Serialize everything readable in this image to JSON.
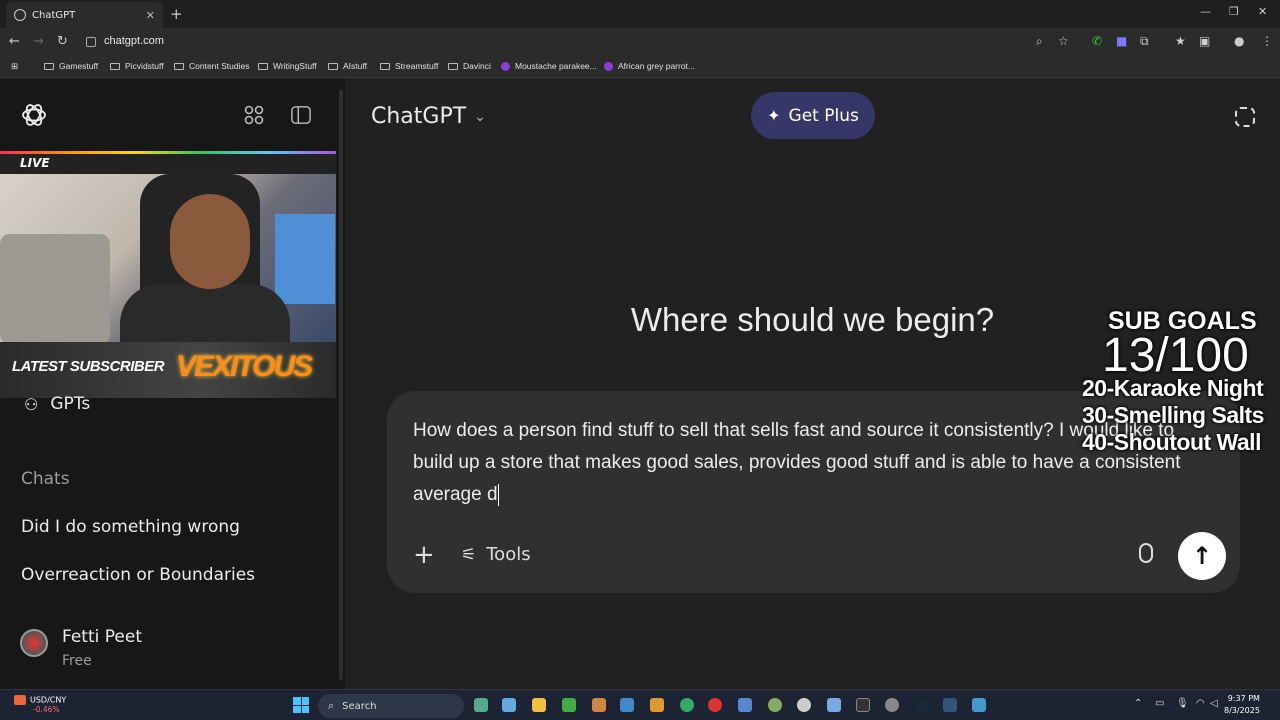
{
  "browser": {
    "tab_title": "ChatGPT",
    "tab_close": "✕",
    "new_tab": "+",
    "url": "chatgpt.com",
    "bookmarks": [
      {
        "label": "Gamestuff",
        "type": "folder"
      },
      {
        "label": "Picvidstuff",
        "type": "folder"
      },
      {
        "label": "Content Studies",
        "type": "folder"
      },
      {
        "label": "WritingStuff",
        "type": "folder"
      },
      {
        "label": "AIstuff",
        "type": "folder"
      },
      {
        "label": "Streamstuff",
        "type": "folder"
      },
      {
        "label": "Davinci",
        "type": "folder"
      },
      {
        "label": "Moustache parakee...",
        "type": "site"
      },
      {
        "label": "African grey parrot...",
        "type": "site"
      }
    ]
  },
  "sidebar": {
    "live_label": "LIVE",
    "latest_subscriber_label": "LATEST SUBSCRIBER",
    "latest_subscriber_name": "VEXITOUS",
    "gpts_label": "GPTs",
    "chats_heading": "Chats",
    "chats": [
      "Did I do something wrong",
      "Overreaction or Boundaries"
    ],
    "user": {
      "name": "Fetti Peet",
      "plan": "Free"
    }
  },
  "main": {
    "model_name": "ChatGPT",
    "get_plus_label": "Get Plus",
    "headline": "Where should we begin?",
    "composer_text": "How does a person find stuff to sell that sells fast and source it consistently? I would like to build up a store that makes good sales, provides good stuff and is able to have a consistent average d",
    "tools_label": "Tools"
  },
  "overlay": {
    "title": "SUB GOALS",
    "count": "13/100",
    "goals": [
      "20-Karaoke Night",
      "30-Smelling Salts",
      "40-Shoutout Wall"
    ]
  },
  "taskbar": {
    "widget_label": "USD/CNY",
    "widget_change": "-0.46%",
    "search_label": "Search",
    "time": "9:37 PM",
    "date": "8/3/2025"
  },
  "colors": {
    "accent_plus": "#373669",
    "sidebar_bg": "#171717",
    "main_bg": "#212121",
    "composer_bg": "#303030"
  }
}
